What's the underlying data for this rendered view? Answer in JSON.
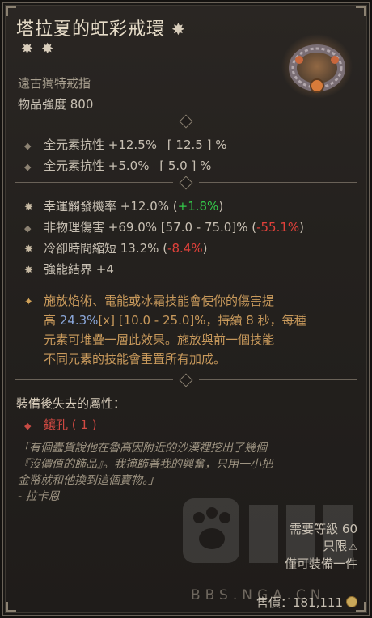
{
  "item": {
    "name": "塔拉夏的虹彩戒環",
    "type": "遠古獨特戒指",
    "power": "物品強度 800",
    "colors": {
      "name": "#e6dcc8",
      "unique_text": "#c99a5c",
      "positive": "#34c94a",
      "negative": "#e0413a",
      "muted": "#a89f8f"
    }
  },
  "implicits": [
    {
      "text": "全元素抗性 +12.5%",
      "range": "[ 12.5 ] %"
    },
    {
      "text": "全元素抗性 +5.0%",
      "range": "[ 5.0 ] %"
    }
  ],
  "affixes": [
    {
      "text": "幸運觸發機率 +12.0%",
      "delta_open": " (",
      "delta": "+1.8%",
      "delta_close": ")"
    },
    {
      "text": "非物理傷害 +69.0% [57.0 - 75.0]%",
      "delta_open": " (",
      "delta": "-55.1%",
      "delta_close": ")"
    },
    {
      "text": "冷卻時間縮短 13.2%",
      "delta_open": " (",
      "delta": "-8.4%",
      "delta_close": ")"
    },
    {
      "text": "強能結界 +4"
    }
  ],
  "unique_aspect": {
    "line1": "施放焰術、電能或冰霜技能會使你的傷害提",
    "line2_a": "高 ",
    "line2_value": "24.3%",
    "line2_b": "[x] [10.0 - 25.0]%，持續 8 秒，每種",
    "line3": "元素可堆疊一層此效果。施放與前一個技能",
    "line4": "不同元素的技能會重置所有加成。"
  },
  "lost_on_equip": {
    "heading": "裝備後失去的屬性：",
    "items": [
      "鑲孔 ( 1 )"
    ]
  },
  "flavor": {
    "line1": "「有個蠹貨說他在魯高因附近的沙漠裡挖出了幾個",
    "line2": "『沒價值的飾品』。我掩飾著我的興奮，只用一小把",
    "line3": "金幣就和他換到這個寶物。」",
    "author": "- 拉卡恩"
  },
  "requirements": {
    "level": "需要等級 60",
    "account_bound": "只限",
    "unique_equipped": "僅可裝備一件"
  },
  "price": "售價：181,111",
  "watermark": "BBS.NGA.CN",
  "icons": [
    "rarity-star-icon",
    "ring-item-icon",
    "stat-bullet-icon",
    "aspect-star-icon",
    "gold-coin-icon",
    "account-bound-icon"
  ]
}
